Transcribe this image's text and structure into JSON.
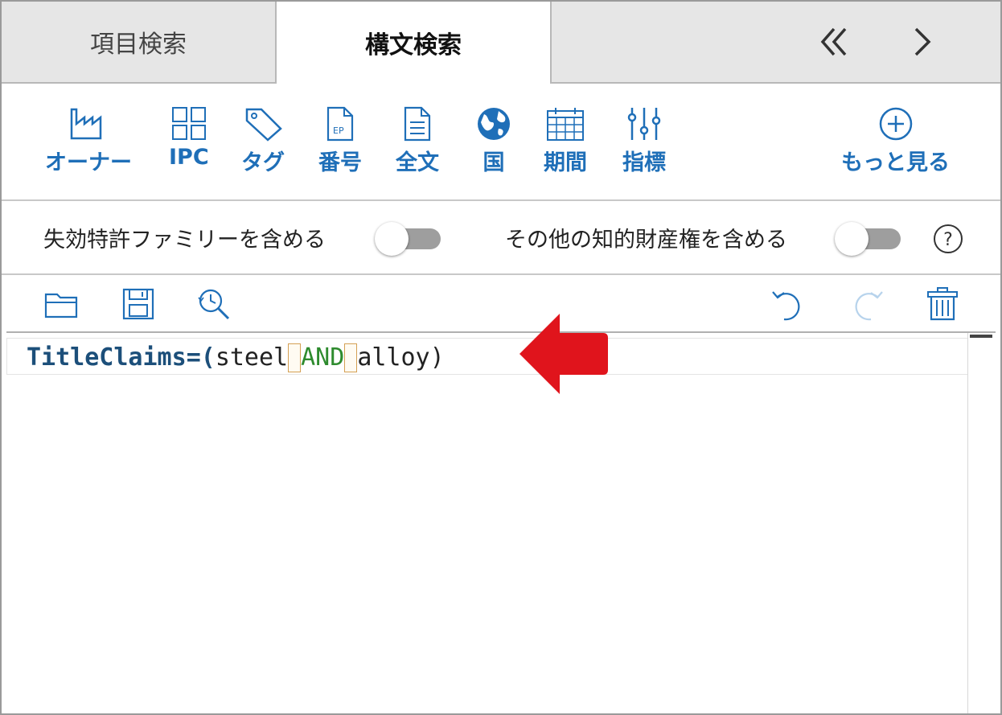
{
  "tabs": [
    {
      "label": "項目検索",
      "active": false
    },
    {
      "label": "構文検索",
      "active": true
    }
  ],
  "nav": {
    "prev_icon": "double-chevron-left-icon",
    "next_icon": "chevron-right-icon"
  },
  "field_buttons": [
    {
      "label": "オーナー",
      "icon": "factory-icon"
    },
    {
      "label": "IPC",
      "icon": "grid-icon"
    },
    {
      "label": "タグ",
      "icon": "tag-icon"
    },
    {
      "label": "番号",
      "icon": "ep-document-icon"
    },
    {
      "label": "全文",
      "icon": "document-icon"
    },
    {
      "label": "国",
      "icon": "globe-icon"
    },
    {
      "label": "期間",
      "icon": "calendar-icon"
    },
    {
      "label": "指標",
      "icon": "sliders-icon"
    },
    {
      "label": "もっと見る",
      "icon": "plus-circle-icon"
    }
  ],
  "options": {
    "lapsed_family_label": "失効特許ファミリーを含める",
    "lapsed_family_on": false,
    "other_ip_label": "その他の知的財産権を含める",
    "other_ip_on": false,
    "help_label": "?"
  },
  "editor_toolbar": {
    "left": [
      "folder-open-icon",
      "save-icon",
      "history-search-icon"
    ],
    "right": [
      "undo-icon",
      "redo-icon",
      "trash-icon"
    ]
  },
  "query": {
    "field": "TitleClaims",
    "equals": "=(",
    "term1": "steel",
    "operator": "AND",
    "term2": "alloy",
    "close": ")"
  },
  "colors": {
    "accent": "#1f6fb8",
    "field_keyword": "#1c4f7a",
    "operator": "#2e8b2e",
    "arrow": "#e0141c"
  }
}
